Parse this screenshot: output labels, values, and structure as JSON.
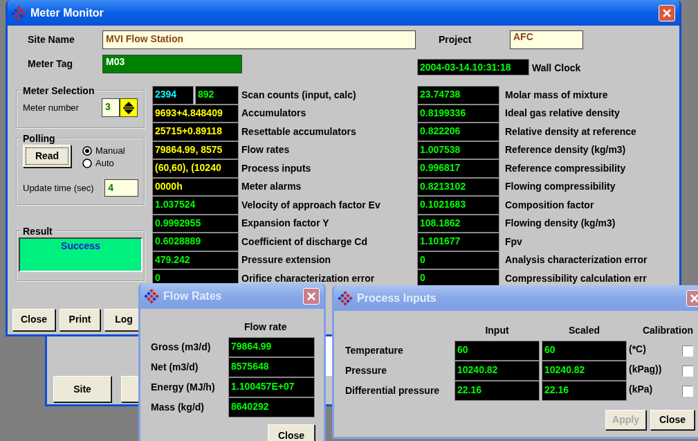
{
  "main_window": {
    "title": "Meter Monitor",
    "active": true,
    "site_name": {
      "label": "Site Name",
      "value": "MVI Flow Station"
    },
    "project": {
      "label": "Project",
      "value": "AFC"
    },
    "meter_tag": {
      "label": "Meter Tag",
      "value": "M03"
    },
    "wall_clock": {
      "value": "2004-03-14.10:31:18",
      "label": "Wall Clock"
    },
    "meter_selection": {
      "title": "Meter Selection",
      "label": "Meter number",
      "value": "3"
    },
    "polling": {
      "title": "Polling",
      "read_button": {
        "label": "Read",
        "focused": true
      },
      "modes": [
        {
          "label": "Manual",
          "selected": true
        },
        {
          "label": "Auto",
          "selected": false
        }
      ],
      "update_label": "Update time (sec)",
      "update_value": "4"
    },
    "result": {
      "title": "Result",
      "value": "Success"
    },
    "readings_left": [
      {
        "values": [
          {
            "text": "2394",
            "color": "#00ffff"
          },
          {
            "text": "892",
            "color": "#00ff00"
          }
        ],
        "label": "Scan counts (input, calc)"
      },
      {
        "values": [
          {
            "text": "9693+4.848409",
            "color": "#ffff00"
          }
        ],
        "label": "Accumulators"
      },
      {
        "values": [
          {
            "text": "25715+0.89118",
            "color": "#ffff00"
          }
        ],
        "label": "Resettable accumulators"
      },
      {
        "values": [
          {
            "text": "79864.99, 8575",
            "color": "#ffff00"
          }
        ],
        "label": "Flow rates"
      },
      {
        "values": [
          {
            "text": "(60,60), (10240",
            "color": "#ffff00"
          }
        ],
        "label": "Process inputs"
      },
      {
        "values": [
          {
            "text": "0000h",
            "color": "#ffff00"
          }
        ],
        "label": "Meter alarms"
      },
      {
        "values": [
          {
            "text": "1.037524",
            "color": "#00ff00"
          }
        ],
        "label": "Velocity of approach factor Ev"
      },
      {
        "values": [
          {
            "text": "0.9992955",
            "color": "#00ff00"
          }
        ],
        "label": "Expansion factor Y"
      },
      {
        "values": [
          {
            "text": "0.6028889",
            "color": "#00ff00"
          }
        ],
        "label": "Coefficient of discharge Cd"
      },
      {
        "values": [
          {
            "text": "479.242",
            "color": "#00ff00"
          }
        ],
        "label": "Pressure extension"
      },
      {
        "values": [
          {
            "text": "0",
            "color": "#00ff00"
          }
        ],
        "label": "Orifice characterization error"
      }
    ],
    "readings_right": [
      {
        "value": "23.74738",
        "label": "Molar mass of mixture"
      },
      {
        "value": "0.8199336",
        "label": "Ideal gas relative density"
      },
      {
        "value": "0.822206",
        "label": "Relative density at reference"
      },
      {
        "value": "1.007538",
        "label": "Reference density (kg/m3)"
      },
      {
        "value": "0.996817",
        "label": "Reference compressibility"
      },
      {
        "value": "0.8213102",
        "label": "Flowing compressibility"
      },
      {
        "value": "0.1021683",
        "label": "Composition factor"
      },
      {
        "value": "108.1862",
        "label": "Flowing density (kg/m3)"
      },
      {
        "value": "1.101677",
        "label": "Fpv"
      },
      {
        "value": "0",
        "label": "Analysis characterization error"
      },
      {
        "value": "0",
        "label": "Compressibility calculation err"
      }
    ],
    "buttons": [
      {
        "label": "Close"
      },
      {
        "label": "Print"
      },
      {
        "label": "Log"
      }
    ]
  },
  "background_window": {
    "buttons": [
      {
        "label": "Site"
      }
    ]
  },
  "flow_rates_window": {
    "title": "Flow Rates",
    "active": false,
    "column": "Flow rate",
    "rows": [
      {
        "label": "Gross (m3/d)",
        "value": "79864.99"
      },
      {
        "label": "Net (m3/d)",
        "value": "8575648"
      },
      {
        "label": "Energy (MJ/h)",
        "value": "1.100457E+07"
      },
      {
        "label": "Mass (kg/d)",
        "value": "8640292"
      }
    ],
    "buttons": [
      {
        "label": "Close"
      }
    ]
  },
  "process_inputs_window": {
    "title": "Process Inputs",
    "active": false,
    "columns": [
      "Input",
      "Scaled",
      "Calibration"
    ],
    "rows": [
      {
        "label": "Temperature",
        "input": "60",
        "scaled": "60",
        "unit": "(*C)",
        "checked": false
      },
      {
        "label": "Pressure",
        "input": "10240.82",
        "scaled": "10240.82",
        "unit": "(kPag))",
        "checked": false
      },
      {
        "label": "Differential pressure",
        "input": "22.16",
        "scaled": "22.16",
        "unit": "(kPa)",
        "checked": false
      }
    ],
    "buttons": [
      {
        "label": "Apply",
        "disabled": true
      },
      {
        "label": "Close",
        "disabled": false
      }
    ]
  }
}
